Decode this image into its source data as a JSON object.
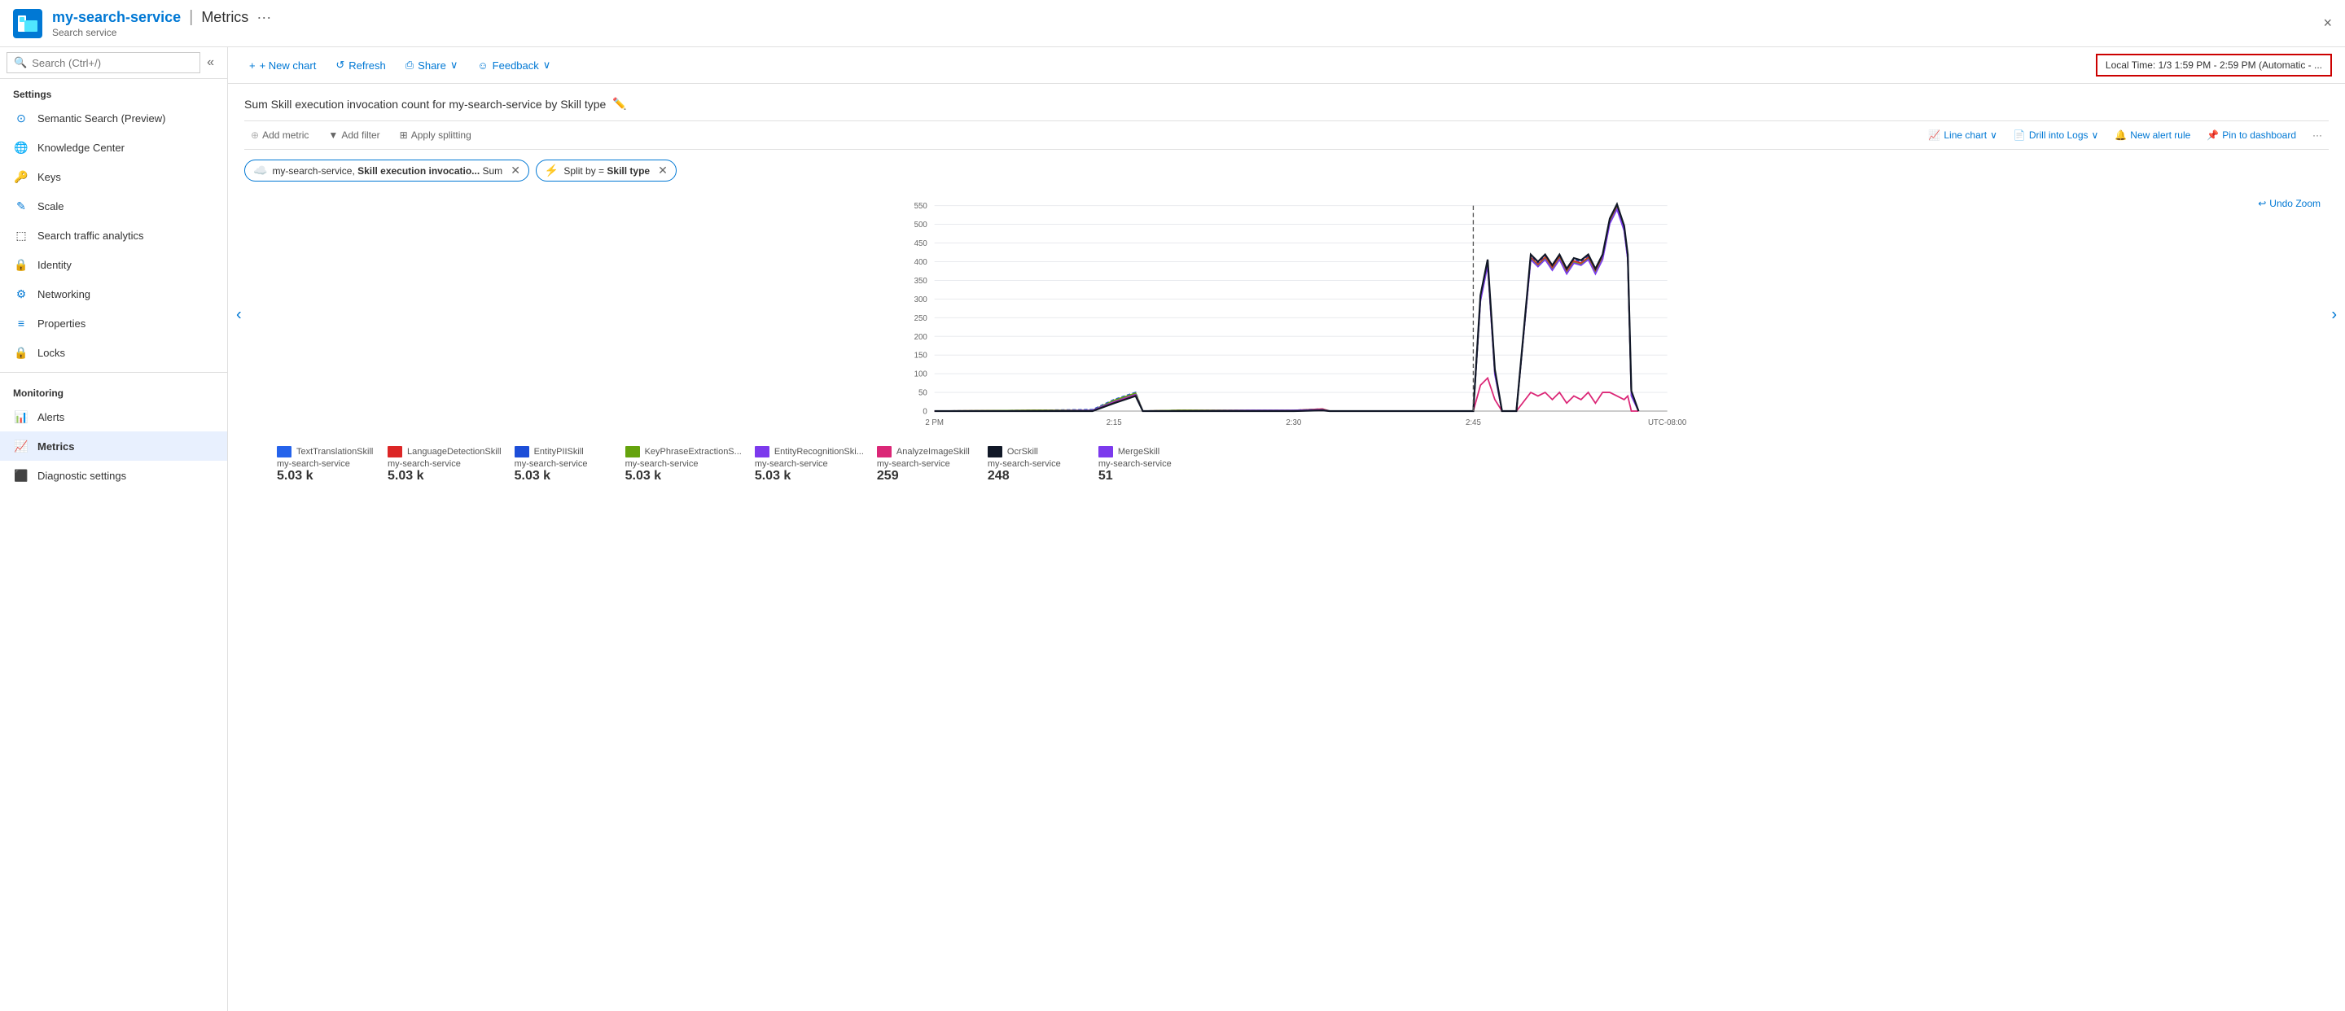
{
  "header": {
    "service_name": "my-search-service",
    "separator": "|",
    "page_title": "Metrics",
    "subtitle": "Search service",
    "more_icon": "···",
    "close_label": "×"
  },
  "sidebar": {
    "search_placeholder": "Search (Ctrl+/)",
    "collapse_icon": "«",
    "sections": [
      {
        "label": "Settings",
        "items": [
          {
            "id": "semantic-search",
            "label": "Semantic Search (Preview)",
            "icon": "🔍",
            "active": false
          },
          {
            "id": "knowledge-center",
            "label": "Knowledge Center",
            "icon": "🌐",
            "active": false
          },
          {
            "id": "keys",
            "label": "Keys",
            "icon": "🔑",
            "active": false
          },
          {
            "id": "scale",
            "label": "Scale",
            "icon": "✏️",
            "active": false
          },
          {
            "id": "search-traffic",
            "label": "Search traffic analytics",
            "icon": "📊",
            "active": false
          },
          {
            "id": "identity",
            "label": "Identity",
            "icon": "🔒",
            "active": false
          },
          {
            "id": "networking",
            "label": "Networking",
            "icon": "🌐",
            "active": false
          },
          {
            "id": "properties",
            "label": "Properties",
            "icon": "⚙️",
            "active": false
          },
          {
            "id": "locks",
            "label": "Locks",
            "icon": "🔒",
            "active": false
          }
        ]
      },
      {
        "label": "Monitoring",
        "items": [
          {
            "id": "alerts",
            "label": "Alerts",
            "icon": "🔔",
            "active": false
          },
          {
            "id": "metrics",
            "label": "Metrics",
            "icon": "📈",
            "active": true
          },
          {
            "id": "diagnostic",
            "label": "Diagnostic settings",
            "icon": "🟢",
            "active": false
          }
        ]
      }
    ]
  },
  "toolbar": {
    "new_chart_label": "+ New chart",
    "refresh_label": "↺ Refresh",
    "share_label": "Share",
    "share_chevron": "∨",
    "feedback_label": "Feedback",
    "feedback_chevron": "∨",
    "time_range_label": "Local Time: 1/3 1:59 PM - 2:59 PM (Automatic - ..."
  },
  "chart": {
    "title": "Sum Skill execution invocation count for my-search-service by Skill type",
    "edit_icon": "✏️",
    "toolbar": {
      "add_metric": "Add metric",
      "add_filter": "Add filter",
      "apply_splitting": "Apply splitting",
      "line_chart": "Line chart",
      "drill_logs": "Drill into Logs",
      "new_alert": "New alert rule",
      "pin_dashboard": "Pin to dashboard",
      "more": "···"
    },
    "pills": [
      {
        "id": "metric-pill",
        "icon": "☁️",
        "text": "my-search-service, Skill execution invocatio... Sum",
        "removable": true
      },
      {
        "id": "split-pill",
        "icon": "⚡",
        "text": "Split by = Skill type",
        "removable": true
      }
    ],
    "undo_zoom": "↩ Undo Zoom",
    "y_axis": [
      550,
      500,
      450,
      400,
      350,
      300,
      250,
      200,
      150,
      100,
      50,
      0
    ],
    "x_axis": [
      "2 PM",
      "2:15",
      "2:30",
      "2:45",
      "UTC-08:00"
    ],
    "legend": [
      {
        "id": "text-translation",
        "label": "TextTranslationSkill",
        "service": "my-search-service",
        "value": "5.03 k",
        "color": "#2563eb"
      },
      {
        "id": "language-detection",
        "label": "LanguageDetectionSkill",
        "service": "my-search-service",
        "value": "5.03 k",
        "color": "#dc2626"
      },
      {
        "id": "entity-pii",
        "label": "EntityPIISkill",
        "service": "my-search-service",
        "value": "5.03 k",
        "color": "#1d4ed8"
      },
      {
        "id": "key-phrase",
        "label": "KeyPhraseExtractionS...",
        "service": "my-search-service",
        "value": "5.03 k",
        "color": "#65a30d"
      },
      {
        "id": "entity-recognition",
        "label": "EntityRecognitionSki...",
        "service": "my-search-service",
        "value": "5.03 k",
        "color": "#7c3aed"
      },
      {
        "id": "analyze-image",
        "label": "AnalyzeImageSkill",
        "service": "my-search-service",
        "value": "259",
        "color": "#db2777"
      },
      {
        "id": "ocr-skill",
        "label": "OcrSkill",
        "service": "my-search-service",
        "value": "248",
        "color": "#111827"
      },
      {
        "id": "merge-skill",
        "label": "MergeSkill",
        "service": "my-search-service",
        "value": "51",
        "color": "#7c3aed"
      }
    ]
  }
}
